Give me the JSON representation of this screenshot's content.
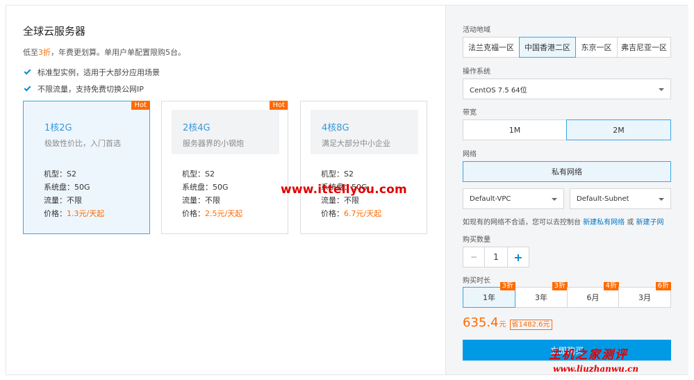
{
  "left": {
    "title": "全球云服务器",
    "promo_pre": "低至",
    "promo_hl": "3折",
    "promo_post": "，年费更划算。单用户单配置限购5台。",
    "features": [
      "标准型实例，适用于大部分应用场景",
      "不限流量，支持免费切换公网IP"
    ],
    "cards": [
      {
        "hot": "Hot",
        "name": "1核2G",
        "desc": "极致性价比，入门首选",
        "model": "机型：S2",
        "disk": "系统盘：50G",
        "traffic": "流量：不限",
        "price_label": "价格：",
        "price_value": "1.3元/天起"
      },
      {
        "hot": "Hot",
        "name": "2核4G",
        "desc": "服务器界的小钢炮",
        "model": "机型：S2",
        "disk": "系统盘：50G",
        "traffic": "流量：不限",
        "price_label": "价格：",
        "price_value": "2.5元/天起"
      },
      {
        "hot": "",
        "name": "4核8G",
        "desc": "满足大部分中小企业",
        "model": "机型：S2",
        "disk": "系统盘：50G",
        "traffic": "流量：不限",
        "price_label": "价格：",
        "price_value": "6.7元/天起"
      }
    ],
    "watermark": "www.ittellyou.com"
  },
  "right": {
    "region_label": "活动地域",
    "regions": [
      "法兰克福一区",
      "中国香港二区",
      "东京一区",
      "弗吉尼亚一区"
    ],
    "os_label": "操作系统",
    "os_value": "CentOS 7.5 64位",
    "bandwidth_label": "带宽",
    "bandwidths": [
      "1M",
      "2M"
    ],
    "network_label": "网络",
    "network_value": "私有网络",
    "vpc_value": "Default-VPC",
    "subnet_value": "Default-Subnet",
    "hint_text": "如现有的网络不合适，您可以去控制台 ",
    "hint_link1": "新建私有网络",
    "hint_or": " 或 ",
    "hint_link2": "新建子网",
    "qty_label": "购买数量",
    "qty_minus": "−",
    "qty_value": "1",
    "qty_plus": "+",
    "duration_label": "购买时长",
    "durations": [
      {
        "label": "1年",
        "discount": "3折"
      },
      {
        "label": "3年",
        "discount": "3折"
      },
      {
        "label": "6月",
        "discount": "4折"
      },
      {
        "label": "3月",
        "discount": "6折"
      }
    ],
    "price": "635.4",
    "price_unit": "元",
    "saving": "省1482.6元",
    "buy_label": "立即购买",
    "watermark_cn": "主机之家测评",
    "watermark_url": "www.liuzhanwu.cn"
  }
}
